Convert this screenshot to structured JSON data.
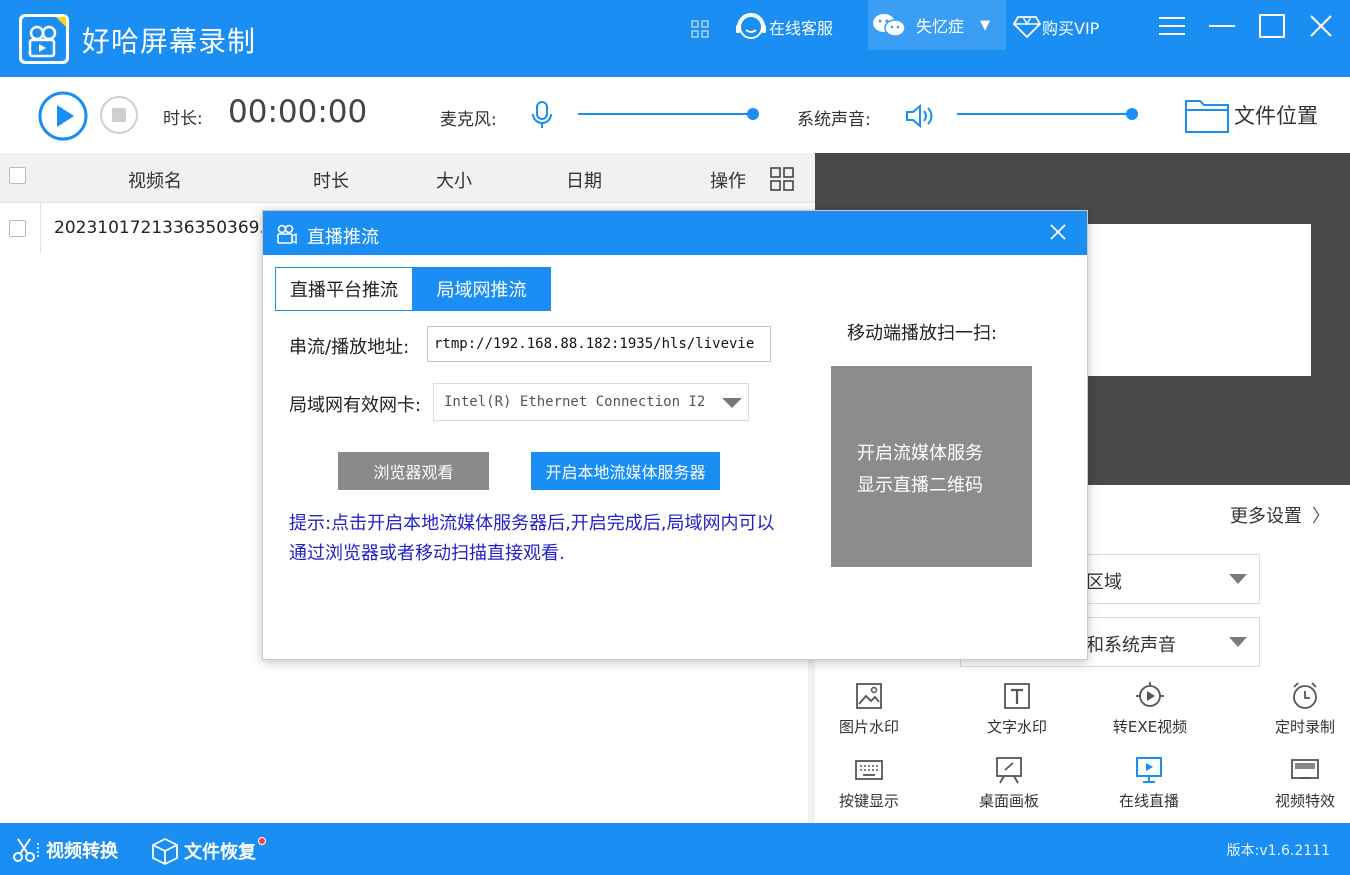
{
  "titlebar": {
    "app_title": "好哈屏幕录制",
    "customer_service": "在线客服",
    "username": "失忆症",
    "buy_vip": "购买VIP",
    "accent_color": "#1a8ef2"
  },
  "toolbar": {
    "duration_label": "时长:",
    "duration_value": "00:00:00",
    "mic_label": "麦克风:",
    "system_sound_label": "系统声音:",
    "file_location": "文件位置"
  },
  "table": {
    "headers": [
      "视频名",
      "时长",
      "大小",
      "日期",
      "操作"
    ],
    "rows": [
      {
        "name": "20231017213363503​69..."
      }
    ]
  },
  "right_panel": {
    "more_settings": "更多设置",
    "dropdown1": "区域",
    "dropdown2": "和系统声音"
  },
  "tools": [
    {
      "label": "图片水印",
      "icon": "image-watermark-icon"
    },
    {
      "label": "文字水印",
      "icon": "text-watermark-icon"
    },
    {
      "label": "转EXE视频",
      "icon": "exe-video-icon"
    },
    {
      "label": "定时录制",
      "icon": "alarm-clock-icon"
    },
    {
      "label": "按键显示",
      "icon": "keyboard-icon"
    },
    {
      "label": "桌面画板",
      "icon": "drawing-board-icon"
    },
    {
      "label": "在线直播",
      "icon": "live-broadcast-icon"
    },
    {
      "label": "视频特效",
      "icon": "video-effects-icon"
    }
  ],
  "bottombar": {
    "video_convert": "视频转换",
    "file_recover": "文件恢复",
    "version": "版本:v1.6.2111"
  },
  "dialog": {
    "title": "直播推流",
    "tab_platform": "直播平台推流",
    "tab_lan": "局域网推流",
    "stream_label": "串流/播放地址:",
    "stream_url": "rtmp://192.168.88.182:1935/hls/livevie",
    "nic_label": "局域网有效网卡:",
    "nic_value": "Intel(R) Ethernet Connection I2",
    "browser_button": "浏览器观看",
    "start_server_button": "开启本地流媒体服务器",
    "hint": "提示:点击开启本地流媒体服务器后,开启完成后,局域网内可以通过浏览器或者移动扫描直接观看.",
    "qr_label": "移动端播放扫一扫:",
    "qr_placeholder_line1": "开启流媒体服务",
    "qr_placeholder_line2": "显示直播二维码"
  }
}
